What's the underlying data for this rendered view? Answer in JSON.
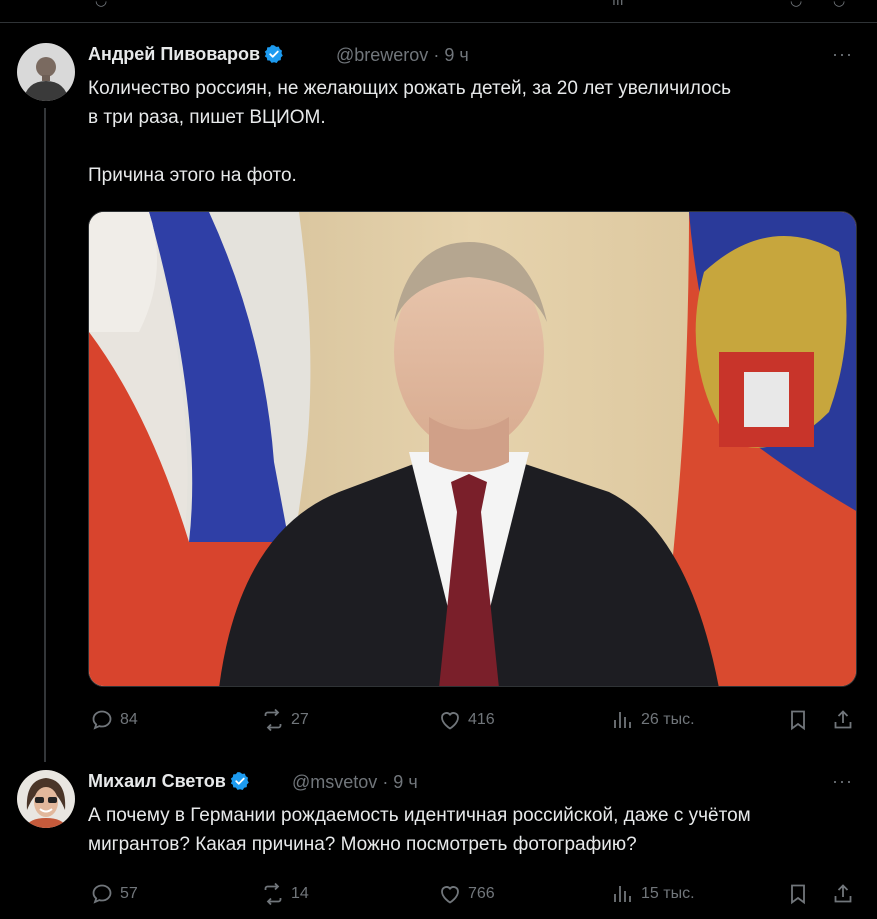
{
  "colors": {
    "background": "#000000",
    "text": "#e7e9ea",
    "muted": "#71767b",
    "verified": "#1d9bf0",
    "divider": "#2f3336"
  },
  "tweets": [
    {
      "author": "Андрей Пивоваров",
      "handle": "@brewerov",
      "time": "· 9 ч",
      "text": "Количество россиян, не желающих рожать детей, за 20 лет увеличилось\nв три раза, пишет ВЦИОМ.\n\nПричина этого на фото.",
      "replies": "84",
      "retweets": "27",
      "likes": "416",
      "views": "26 тыс."
    },
    {
      "author": "Михаил Светов",
      "handle": "@msvetov",
      "time": "· 9 ч",
      "text": "А почему в Германии рождаемость идентичная российской, даже с учётом\nмигрантов? Какая причина? Можно посмотреть фотографию?",
      "replies": "57",
      "retweets": "14",
      "likes": "766",
      "views": "15 тыс."
    }
  ],
  "icons": [
    "reply-icon",
    "retweet-icon",
    "like-icon",
    "views-icon",
    "bookmark-icon",
    "share-icon",
    "more-icon",
    "verified-badge-icon"
  ]
}
